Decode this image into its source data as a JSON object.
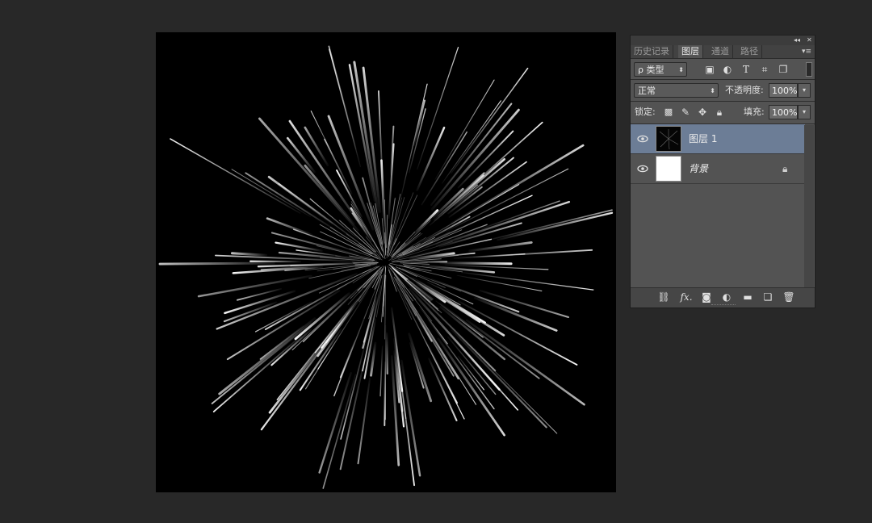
{
  "panel": {
    "tabs": [
      {
        "label": "历史记录",
        "active": false
      },
      {
        "label": "图层",
        "active": true
      },
      {
        "label": "通道",
        "active": false
      },
      {
        "label": "路径",
        "active": false
      }
    ],
    "collapse_glyph": "◂◂",
    "close_glyph": "✕",
    "menu_glyph": "▾≡",
    "filter": {
      "label": "ρ 类型",
      "icons": [
        "image-filter-icon",
        "adjustment-filter-icon",
        "type-filter-icon",
        "shape-filter-icon",
        "smart-object-filter-icon"
      ]
    },
    "blend_mode": "正常",
    "opacity_label": "不透明度:",
    "opacity_value": "100%",
    "lock_label": "锁定:",
    "fill_label": "填充:",
    "fill_value": "100%",
    "layers": [
      {
        "name": "图层 1",
        "selected": true,
        "visible": true,
        "locked": false,
        "thumb": "dark"
      },
      {
        "name": "背景",
        "selected": false,
        "visible": true,
        "locked": true,
        "thumb": "white"
      }
    ],
    "footer_icons": [
      "link-layers-icon",
      "fx-icon",
      "layer-mask-icon",
      "adjustment-layer-icon",
      "group-folder-icon",
      "new-layer-icon",
      "delete-layer-icon"
    ],
    "fx_label": "fx."
  },
  "colors": {
    "workspace": "#282828",
    "canvas": "#000000",
    "selection": "#6c7d96",
    "panel": "#535353"
  }
}
